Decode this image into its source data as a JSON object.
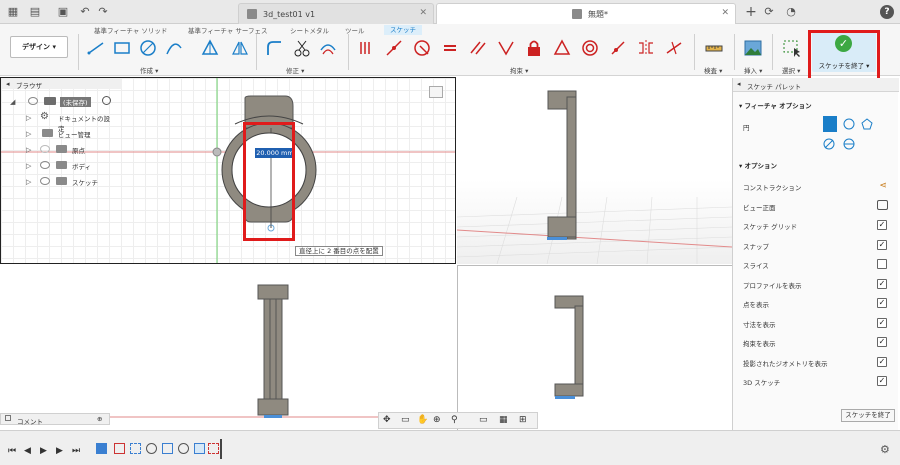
{
  "tabs": {
    "doc1": "3d_test01 v1",
    "doc2": "無題*"
  },
  "ribbon": {
    "tabs": [
      "基準フィーチャ ソリッド",
      "基準フィーチャ サーフェス",
      "シートメタル",
      "ツール",
      "スケッチ"
    ],
    "active_tab": "スケッチ",
    "design_label": "デザイン ▾",
    "groups": {
      "create": "作成 ▾",
      "modify": "修正 ▾",
      "constraints": "拘束 ▾",
      "inspect": "検査 ▾",
      "insert": "挿入 ▾",
      "select": "選択 ▾"
    },
    "finish_sketch_label": "スケッチを終了 ▾"
  },
  "browser": {
    "title": "ブラウザ",
    "root_label": "(未保存)",
    "items": [
      "ドキュメントの設定",
      "ビュー管理",
      "原点",
      "ボディ",
      "スケッチ"
    ]
  },
  "viewport": {
    "dimension_value": "20.000 mm",
    "tooltip": "直径上に 2 番目の点を配置",
    "comment_label": "コメント"
  },
  "palette": {
    "title": "スケッチ パレット",
    "feature_options_head": "フィーチャ オプション",
    "circle_label": "円",
    "options_head": "オプション",
    "options": [
      {
        "label": "コンストラクション",
        "checked": null
      },
      {
        "label": "ビュー正面",
        "checked": null
      },
      {
        "label": "スケッチ グリッド",
        "checked": true
      },
      {
        "label": "スナップ",
        "checked": true
      },
      {
        "label": "スライス",
        "checked": false
      },
      {
        "label": "プロファイルを表示",
        "checked": true
      },
      {
        "label": "点を表示",
        "checked": true
      },
      {
        "label": "寸法を表示",
        "checked": true
      },
      {
        "label": "拘束を表示",
        "checked": true
      },
      {
        "label": "投影されたジオメトリを表示",
        "checked": true
      },
      {
        "label": "3D スケッチ",
        "checked": true
      }
    ],
    "finish_button": "スケッチを終了"
  },
  "colors": {
    "accent": "#1a7ec8",
    "finish_green": "#3da843",
    "highlight_red": "#e01b1b",
    "model_gray": "#8f8a80"
  }
}
